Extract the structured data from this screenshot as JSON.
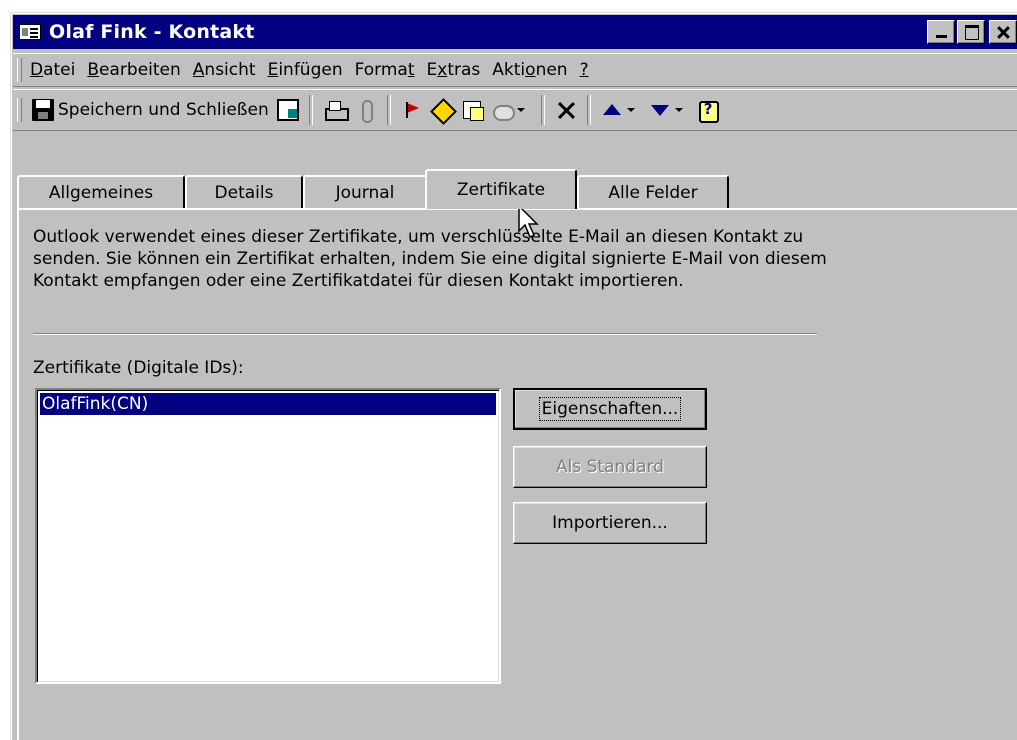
{
  "window": {
    "title": "Olaf Fink - Kontakt"
  },
  "menu": [
    "Datei",
    "Bearbeiten",
    "Ansicht",
    "Einfügen",
    "Format",
    "Extras",
    "Aktionen",
    "?"
  ],
  "menu_underline": [
    "D",
    "B",
    "A",
    "E",
    "t",
    "x",
    "o",
    "?"
  ],
  "toolbar": {
    "save_close_label": "Speichern und Schließen"
  },
  "tabs": [
    "Allgemeines",
    "Details",
    "Journal",
    "Zertifikate",
    "Alle Felder"
  ],
  "active_tab": "Zertifikate",
  "certificates": {
    "description": "Outlook verwendet eines dieser Zertifikate, um verschlüsselte E-Mail an diesen Kontakt zu senden. Sie können ein Zertifikat erhalten, indem Sie eine digital signierte E-Mail von diesem Kontakt empfangen oder eine Zertifikatdatei für diesen Kontakt importieren.",
    "list_label": "Zertifikate (Digitale IDs):",
    "items": [
      "OlafFink(CN)"
    ],
    "btn_properties": "Eigenschaften...",
    "btn_default": "Als Standard",
    "btn_import": "Importieren..."
  },
  "colors": {
    "titlebar": "#000080",
    "face": "#c0c0c0",
    "selection": "#000080"
  }
}
